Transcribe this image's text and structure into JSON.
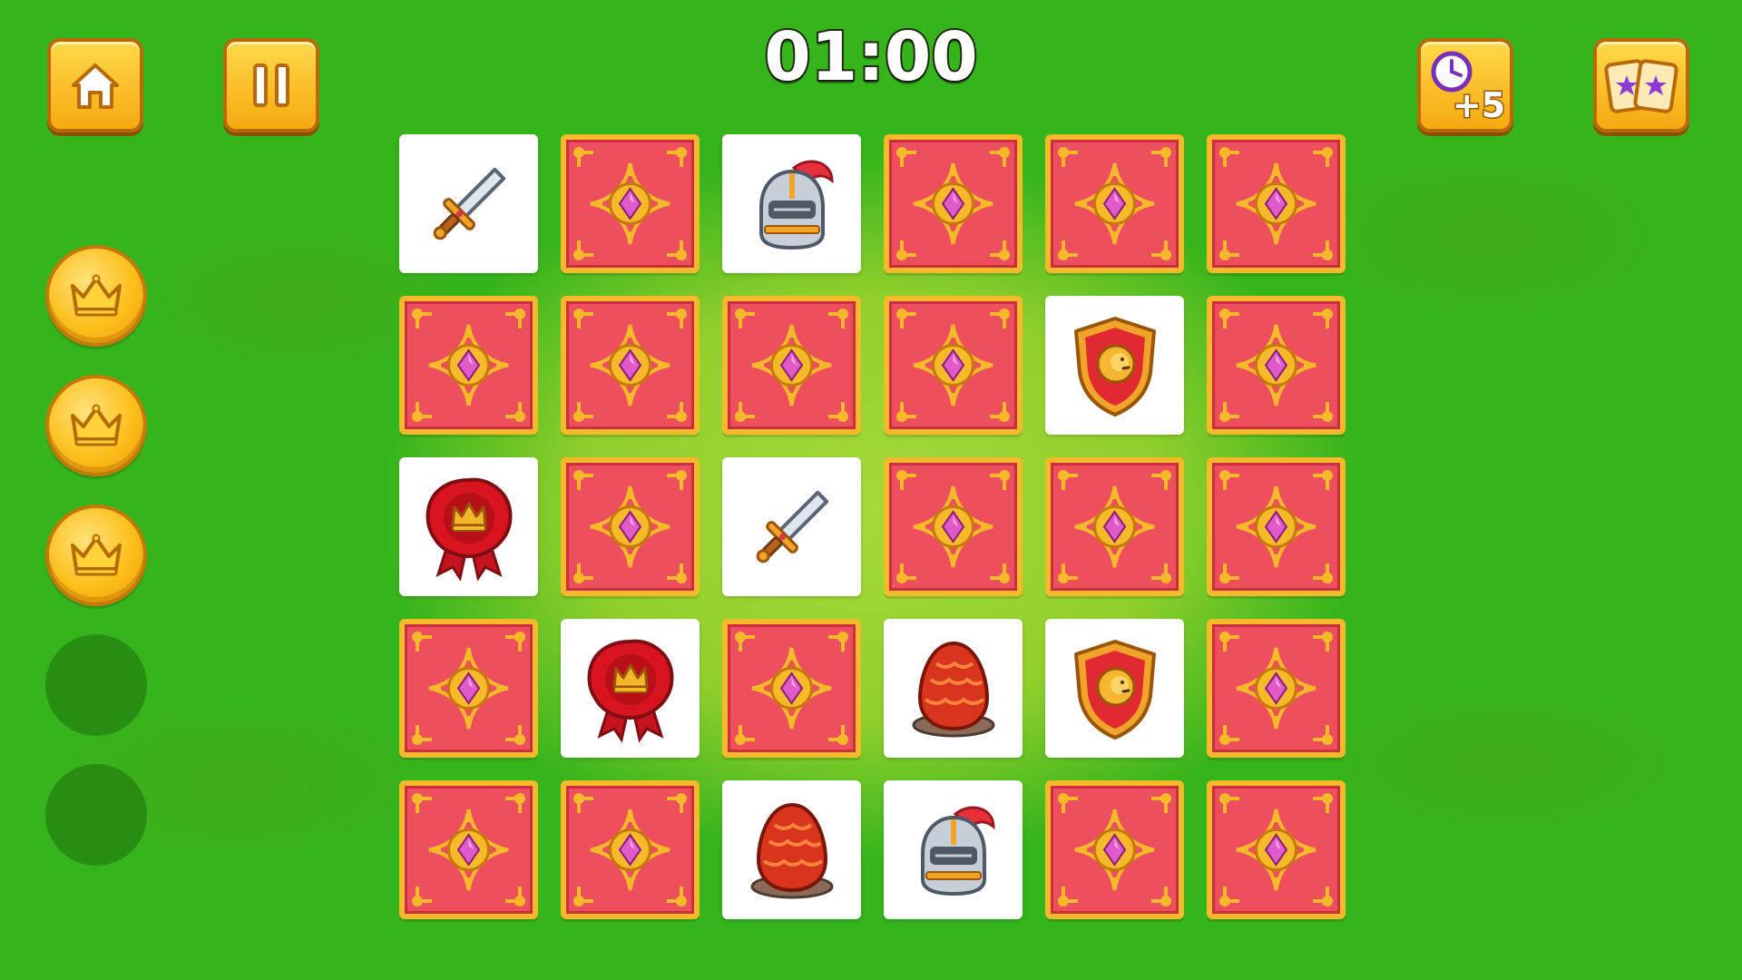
{
  "game": {
    "timer": "01:00",
    "buttons": {
      "home": {
        "icon": "home-icon"
      },
      "pause": {
        "icon": "pause-icon"
      },
      "add_time": {
        "icon": "clock-plus-icon",
        "label": "+5"
      },
      "reveal_cards": {
        "icon": "cards-stars-icon"
      }
    },
    "coins": [
      "earned",
      "earned",
      "earned",
      "empty",
      "empty"
    ],
    "board": {
      "rows": 5,
      "cols": 6,
      "cards": [
        "sword",
        "back",
        "knight-helmet",
        "back",
        "back",
        "back",
        "back",
        "back",
        "back",
        "back",
        "lion-shield",
        "back",
        "wax-seal",
        "back",
        "sword",
        "back",
        "back",
        "back",
        "back",
        "wax-seal",
        "back",
        "dragon-egg",
        "lion-shield",
        "back",
        "back",
        "back",
        "dragon-egg",
        "knight-helmet",
        "back",
        "back"
      ]
    },
    "colors": {
      "background": "#36b41c",
      "card_back": "#ee4f5d",
      "card_frame": "#f6b92a",
      "gem": "#e05bc8",
      "button_gold": "#fbbf1b"
    }
  }
}
